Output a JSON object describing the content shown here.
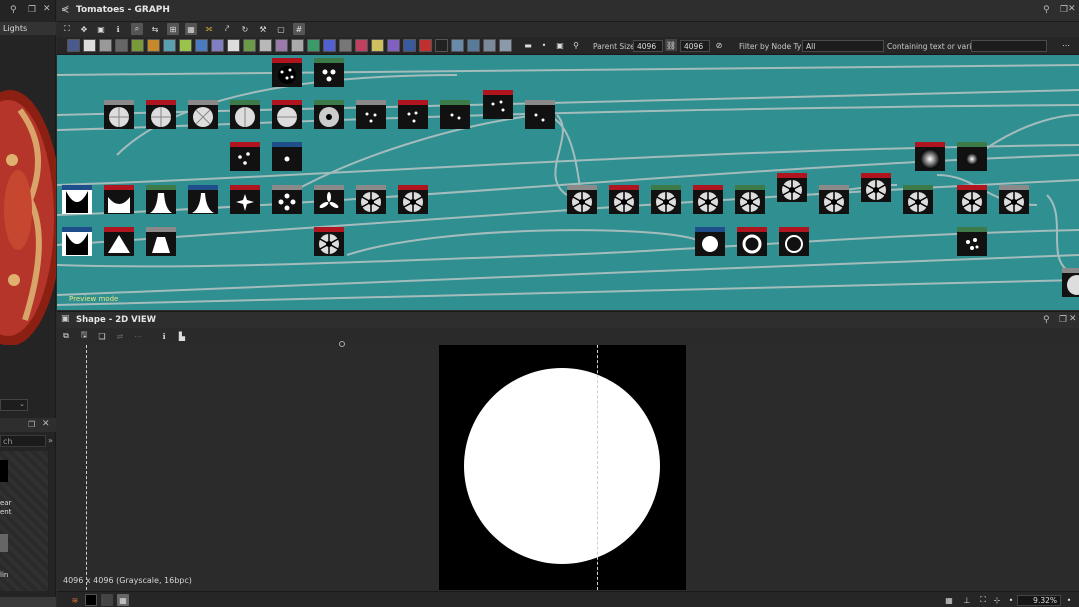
{
  "left_panel": {
    "header": "Lights",
    "search_placeholder": "ch",
    "partial_labels": [
      "ear",
      "ent",
      "lin"
    ]
  },
  "graph_window": {
    "title": "Tomatoes - GRAPH",
    "parent_size_label": "Parent Size:",
    "parent_size_value": "4096",
    "size_value": "4096",
    "filter_label": "Filter by Node Type",
    "filter_value": "All",
    "containing_label": "Containing text or variable",
    "preview_mode": "Preview mode"
  },
  "view_window": {
    "title": "Shape - 2D VIEW",
    "image_info": "4096 x 4096 (Grayscale, 16bpc)",
    "zoom": "9.32%"
  },
  "colors": {
    "graph_bg": "#2f8f91",
    "node_header_red": "#b0141f",
    "node_header_gray": "#8a8a8a",
    "node_header_green": "#3c7a4a",
    "node_header_blue": "#1f4f8a"
  }
}
